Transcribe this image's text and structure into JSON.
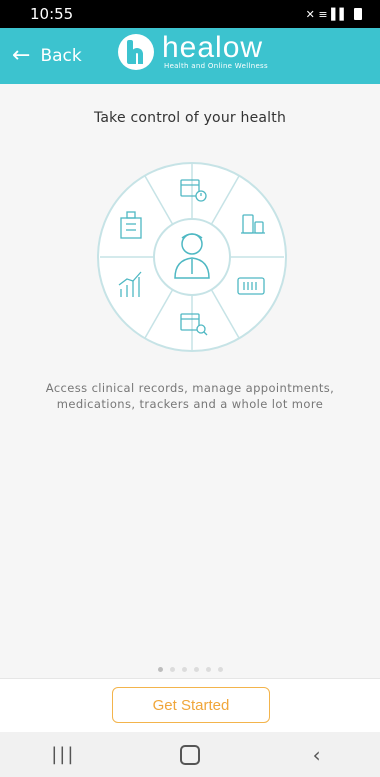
{
  "status": {
    "time": "10:55",
    "icons": "✕ ≡ ▌▌"
  },
  "appbar": {
    "back_label": "Back",
    "logo_word": "healow",
    "logo_tagline": "Health and Online Wellness"
  },
  "headline": "Take control of your health",
  "description": "Access clinical records, manage appointments, medications, trackers and a whole lot more",
  "wheel_segments": [
    "calendar-clock-icon",
    "medication-icon",
    "ticket-barcode-icon",
    "calendar-search-icon",
    "chart-trend-icon",
    "hospital-icon"
  ],
  "center_icon": "doctor-icon",
  "pager": {
    "count": 6,
    "active": 0
  },
  "cta": {
    "label": "Get Started"
  },
  "colors": {
    "accent": "#3cc3cf",
    "cta": "#f0a63a",
    "line": "#c6e3e6"
  }
}
